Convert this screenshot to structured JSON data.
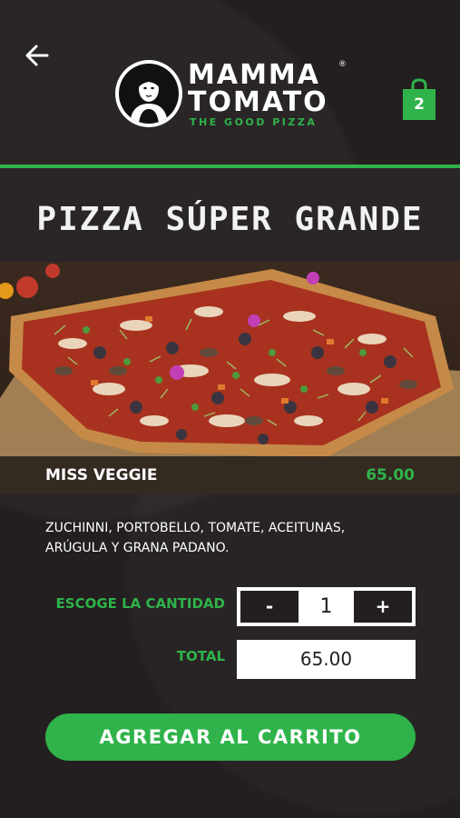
{
  "header": {
    "back_icon": "arrow-left-icon",
    "logo": {
      "line1": "MAMMA",
      "line2": "TOMATO",
      "tagline": "THE GOOD PIZZA",
      "registered": "®"
    },
    "cart": {
      "icon": "shopping-bag-icon",
      "count": "2"
    }
  },
  "page": {
    "title": "PIZZA SÚPER GRANDE"
  },
  "product": {
    "name": "MISS VEGGIE",
    "price": "65.00",
    "description": "ZUCHINNI, PORTOBELLO, TOMATE, ACEITUNAS, ARÚGULA Y GRANA PADANO."
  },
  "quantity": {
    "label": "ESCOGE LA CANTIDAD",
    "minus": "-",
    "value": "1",
    "plus": "+"
  },
  "total": {
    "label": "TOTAL",
    "value": "65.00"
  },
  "cta": {
    "label": "AGREGAR AL CARRITO"
  },
  "colors": {
    "accent": "#2fb34a",
    "background": "#231f20",
    "text": "#ffffff"
  }
}
